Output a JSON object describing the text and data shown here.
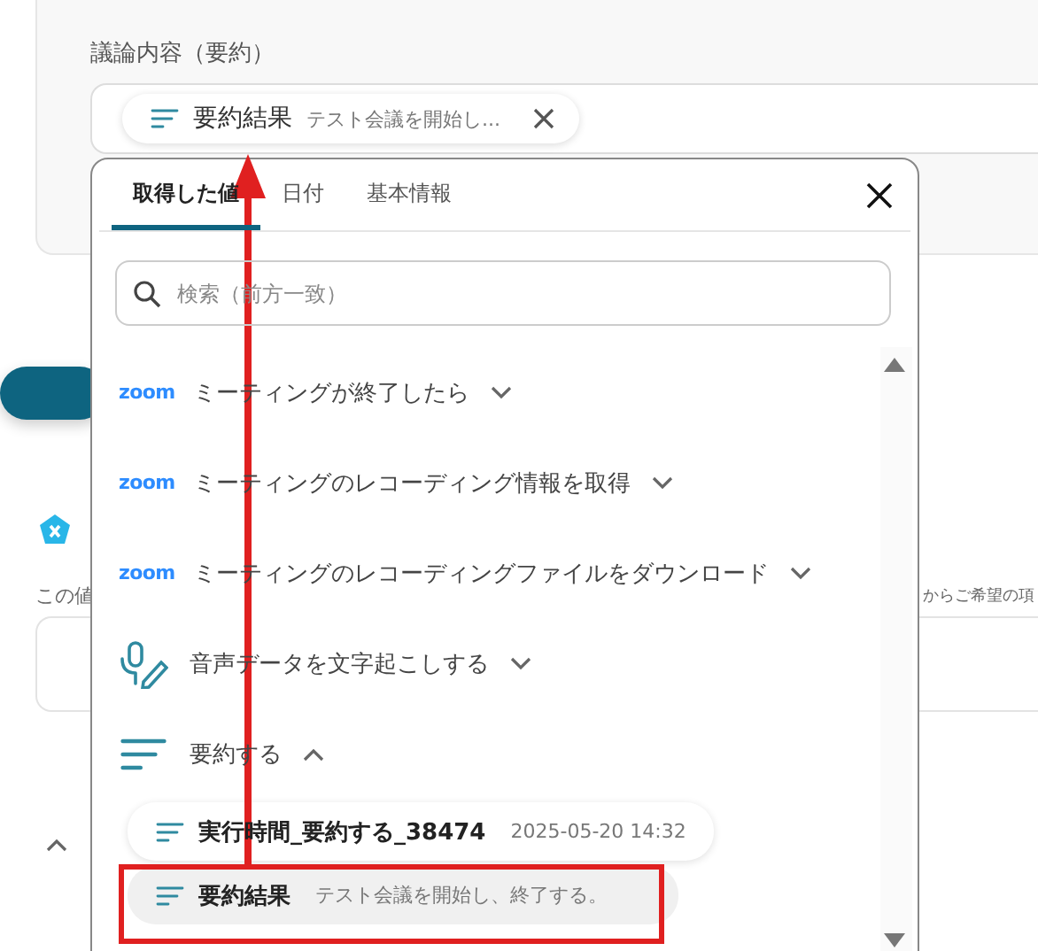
{
  "form": {
    "label": "議論内容（要約）",
    "chip": {
      "title": "要約結果",
      "preview": "テスト会議を開始し..."
    },
    "hint_left": "この値",
    "hint_right": "からご希望の項"
  },
  "picker": {
    "tabs": [
      {
        "label": "取得した値",
        "selected": true
      },
      {
        "label": "日付",
        "selected": false
      },
      {
        "label": "基本情報",
        "selected": false
      }
    ],
    "search": {
      "placeholder": "検索（前方一致）"
    },
    "groups": [
      {
        "kind": "zoom",
        "logo": "zoom",
        "title": "ミーティングが終了したら",
        "expanded": false
      },
      {
        "kind": "zoom",
        "logo": "zoom",
        "title": "ミーティングのレコーディング情報を取得",
        "expanded": false
      },
      {
        "kind": "zoom",
        "logo": "zoom",
        "title": "ミーティングのレコーディングファイルをダウンロード",
        "expanded": false
      },
      {
        "kind": "voice",
        "title": "音声データを文字起こしする",
        "expanded": false
      },
      {
        "kind": "summary",
        "title": "要約する",
        "expanded": true,
        "children": [
          {
            "label": "実行時間_要約する_38474",
            "value": "2025-05-20 14:32",
            "selected": false
          },
          {
            "label": "要約結果",
            "value": "テスト会議を開始し、終了する。",
            "selected": true
          }
        ]
      }
    ]
  }
}
